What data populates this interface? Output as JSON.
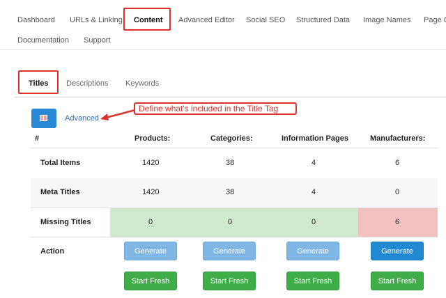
{
  "top_nav": {
    "items": [
      "Dashboard",
      "URLs & Linking",
      "Content",
      "Advanced Editor",
      "Social SEO",
      "Structured Data",
      "Image Names",
      "Page Cr",
      "Documentation",
      "Support"
    ]
  },
  "sub_tabs": {
    "items": [
      "Titles",
      "Descriptions",
      "Keywords"
    ]
  },
  "toolbar": {
    "advanced_link": "Advanced",
    "callout": "Define what's included in the Title Tag"
  },
  "table": {
    "headers": [
      "#",
      "Products:",
      "Categories:",
      "Information Pages",
      "Manufacturers:"
    ],
    "rows": [
      {
        "label": "Total Items",
        "values": [
          "1420",
          "38",
          "4",
          "6"
        ]
      },
      {
        "label": "Meta Titles",
        "values": [
          "1420",
          "38",
          "4",
          "0"
        ]
      },
      {
        "label": "Missing Titles",
        "values": [
          "0",
          "0",
          "0",
          "6"
        ]
      }
    ],
    "action_label": "Action",
    "generate_label": "Generate",
    "start_fresh_label": "Start Fresh"
  },
  "colors": {
    "accent": "#2289d3",
    "success": "#3fae49",
    "highlight": "#e0302b",
    "ok_band": "#cfe9cf",
    "warn_band": "#f3c2c0"
  }
}
